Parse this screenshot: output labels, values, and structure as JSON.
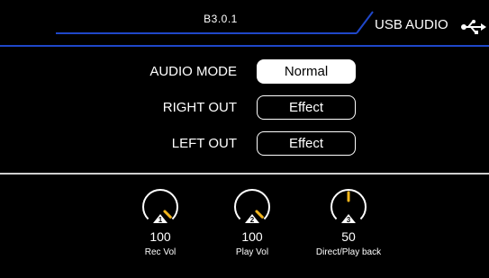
{
  "header": {
    "version": "B3.0.1",
    "title": "USB AUDIO"
  },
  "settings": [
    {
      "label": "AUDIO MODE",
      "value": "Normal",
      "selected": true
    },
    {
      "label": "RIGHT OUT",
      "value": "Effect",
      "selected": false
    },
    {
      "label": "LEFT OUT",
      "value": "Effect",
      "selected": false
    }
  ],
  "knobs": [
    {
      "number": "1",
      "value": "100",
      "level": 1.0,
      "label": "Rec Vol"
    },
    {
      "number": "2",
      "value": "100",
      "level": 1.0,
      "label": "Play Vol"
    },
    {
      "number": "3",
      "value": "50",
      "level": 0.5,
      "label": "Direct/Play back"
    }
  ],
  "colors": {
    "accent_line": "#1f47c9",
    "indicator": "#f2b51c"
  }
}
